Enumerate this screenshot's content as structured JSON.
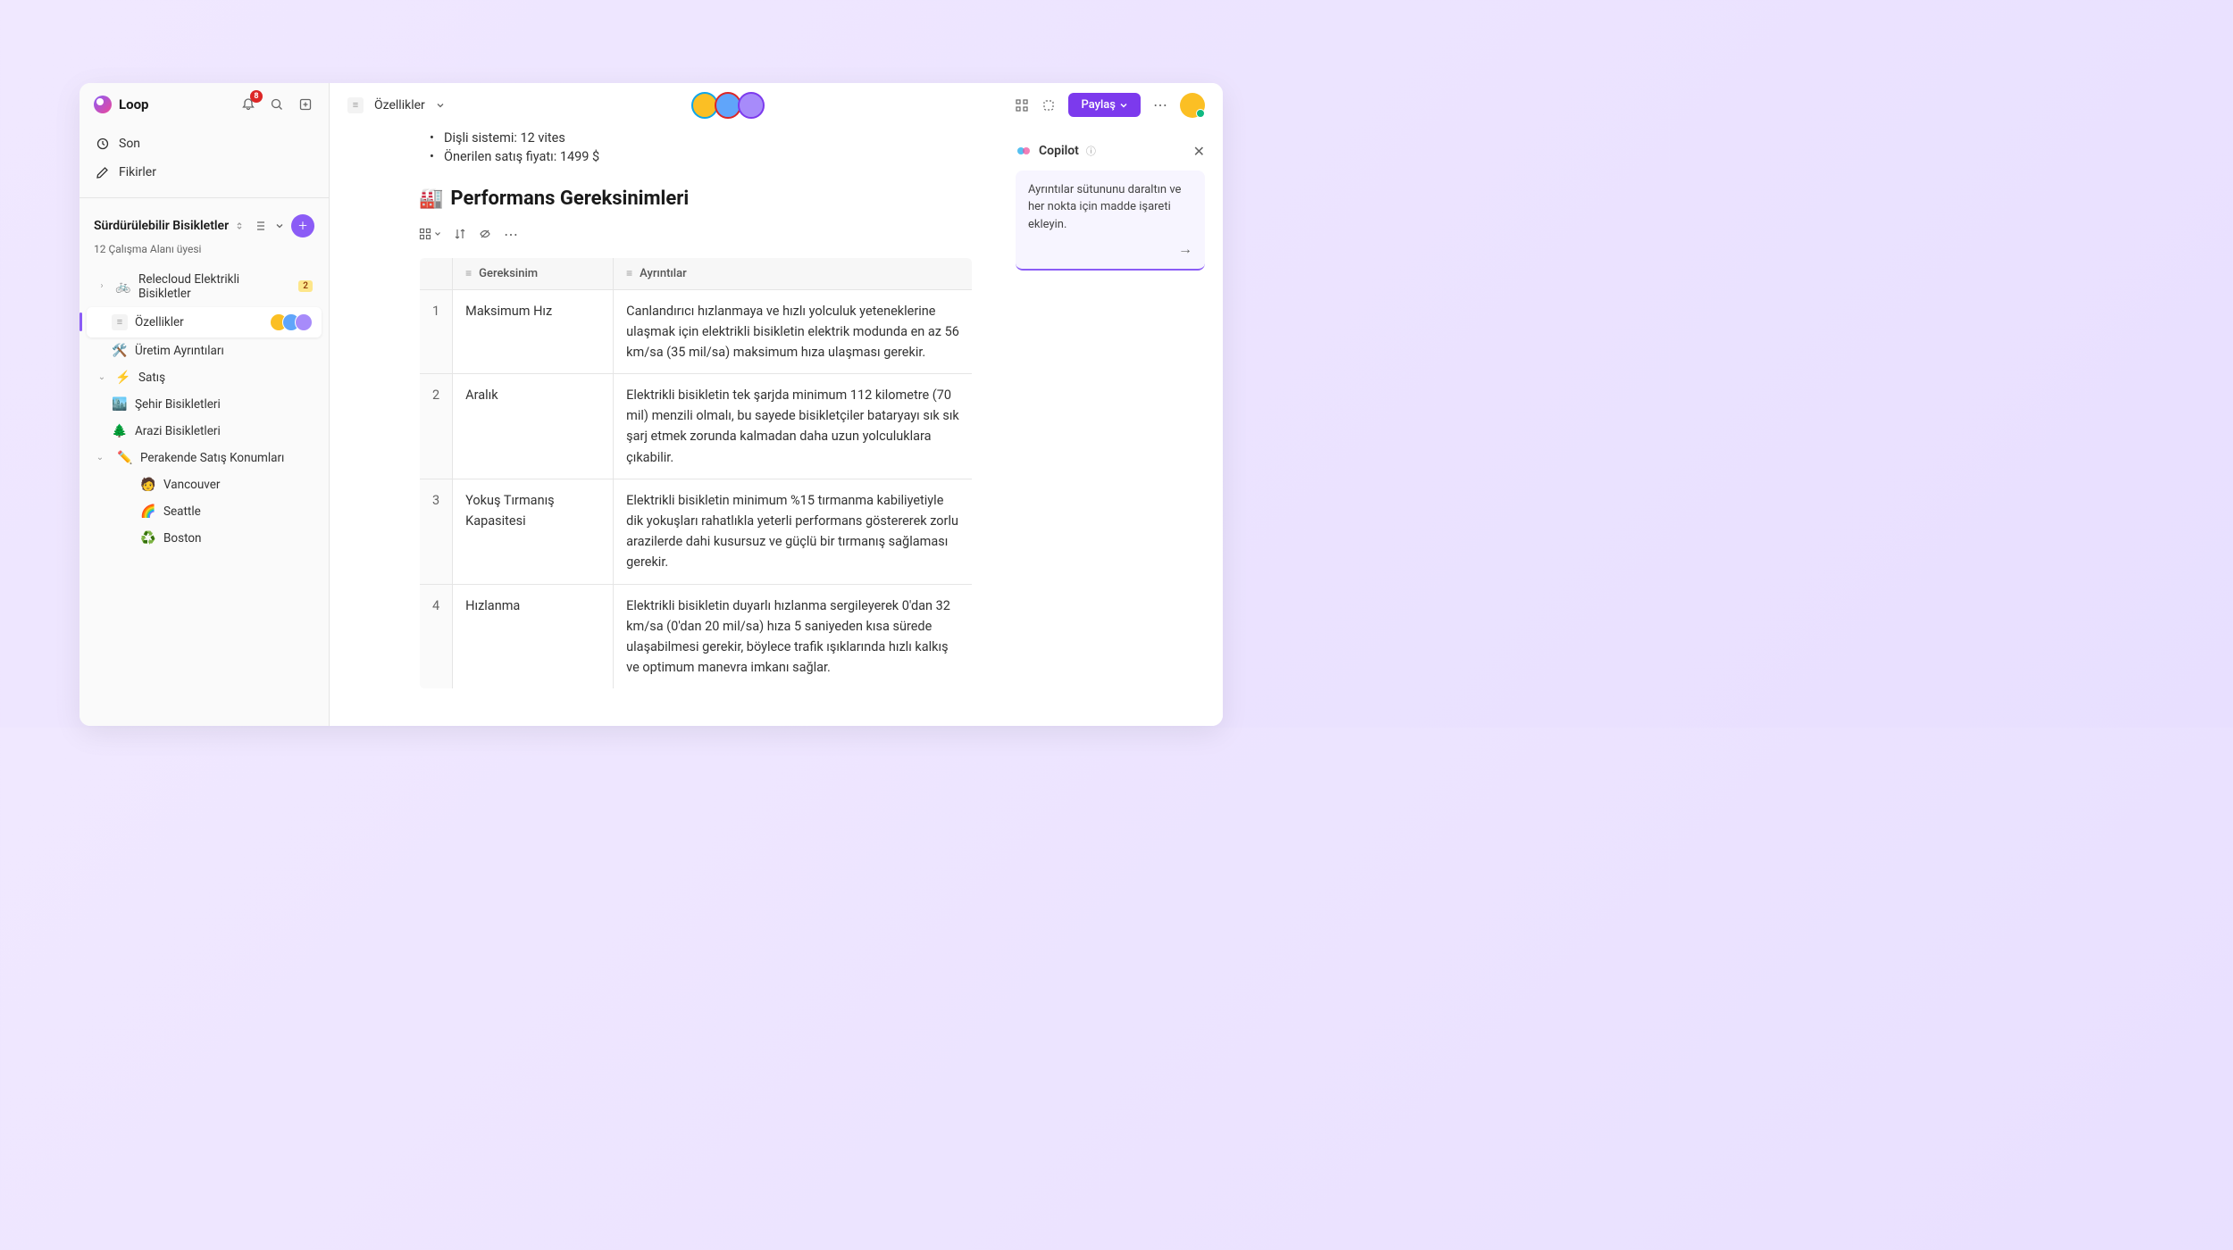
{
  "app": {
    "name": "Loop",
    "notification_count": "8"
  },
  "nav": {
    "recent": "Son",
    "ideas": "Fikirler"
  },
  "workspace": {
    "title": "Sürdürülebilir Bisikletler",
    "subtitle": "12 Çalışma Alanı üyesi"
  },
  "tree": {
    "relecloud": {
      "label": "Relecloud Elektrikli Bisikletler",
      "badge": "2"
    },
    "features": "Özellikler",
    "production": "Üretim Ayrıntıları",
    "sales": "Satış",
    "city": "Şehir Bisikletleri",
    "terrain": "Arazi Bisikletleri",
    "retail": "Perakende Satış Konumları",
    "vancouver": "Vancouver",
    "seattle": "Seattle",
    "boston": "Boston"
  },
  "topbar": {
    "page_title": "Özellikler",
    "share": "Paylaş"
  },
  "doc": {
    "bullets": [
      "Dişli sistemi: 12 vites",
      "Önerilen satış fiyatı: 1499 $"
    ],
    "heading": "Performans Gereksinimleri",
    "heading_emoji": "🏭",
    "table": {
      "col1": "Gereksinim",
      "col2": "Ayrıntılar",
      "rows": [
        {
          "n": "1",
          "req": "Maksimum Hız",
          "det": "Canlandırıcı hızlanmaya ve hızlı yolculuk yeteneklerine ulaşmak için elektrikli bisikletin elektrik modunda en az 56 km/sa (35 mil/sa) maksimum hıza ulaşması gerekir."
        },
        {
          "n": "2",
          "req": "Aralık",
          "det": "Elektrikli bisikletin tek şarjda minimum 112 kilometre (70 mil) menzili olmalı, bu sayede bisikletçiler bataryayı sık sık şarj etmek zorunda kalmadan daha uzun yolculuklara çıkabilir."
        },
        {
          "n": "3",
          "req": "Yokuş Tırmanış Kapasitesi",
          "det": "Elektrikli bisikletin minimum %15 tırmanma kabiliyetiyle dik yokuşları rahatlıkla yeterli performans göstererek zorlu arazilerde dahi kusursuz ve güçlü bir tırmanış sağlaması gerekir."
        },
        {
          "n": "4",
          "req": "Hızlanma",
          "det": "Elektrikli bisikletin duyarlı hızlanma sergileyerek 0'dan 32 km/sa (0'dan 20 mil/sa) hıza 5 saniyeden kısa sürede ulaşabilmesi gerekir, böylece trafik ışıklarında hızlı kalkış ve optimum manevra imkanı sağlar."
        }
      ]
    }
  },
  "copilot": {
    "title": "Copilot",
    "suggestion": "Ayrıntılar sütununu daraltın ve her nokta için madde işareti ekleyin."
  }
}
